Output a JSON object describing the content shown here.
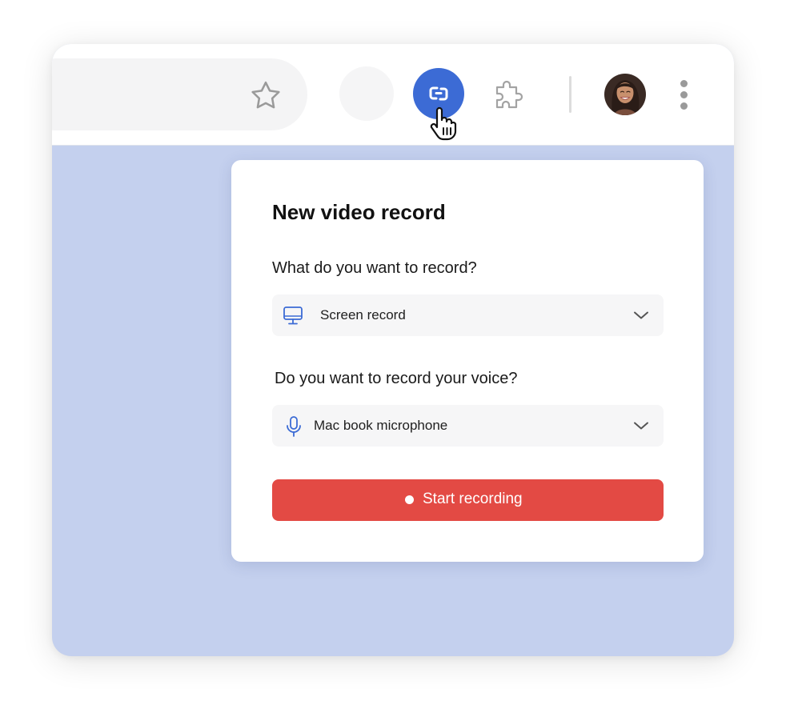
{
  "toolbar": {
    "icons": {
      "bookmark": "star-icon",
      "extension": "screen-recorder-extension-icon",
      "extensions_menu": "puzzle-icon",
      "profile": "avatar",
      "more": "more-vertical-icon",
      "pointer": "hand-cursor-icon"
    },
    "accent_color": "#3c6bd5"
  },
  "popup": {
    "title": "New video record",
    "record_question": "What do you want to record?",
    "record_source": {
      "icon": "monitor-icon",
      "value": "Screen record"
    },
    "voice_question": "Do you want to record your voice?",
    "voice_source": {
      "icon": "microphone-icon",
      "value": "Mac book microphone"
    },
    "start_button": {
      "label": "Start recording",
      "color": "#e34a44"
    }
  },
  "colors": {
    "page_background": "#c4d0ee",
    "toolbar_background": "#ffffff"
  }
}
